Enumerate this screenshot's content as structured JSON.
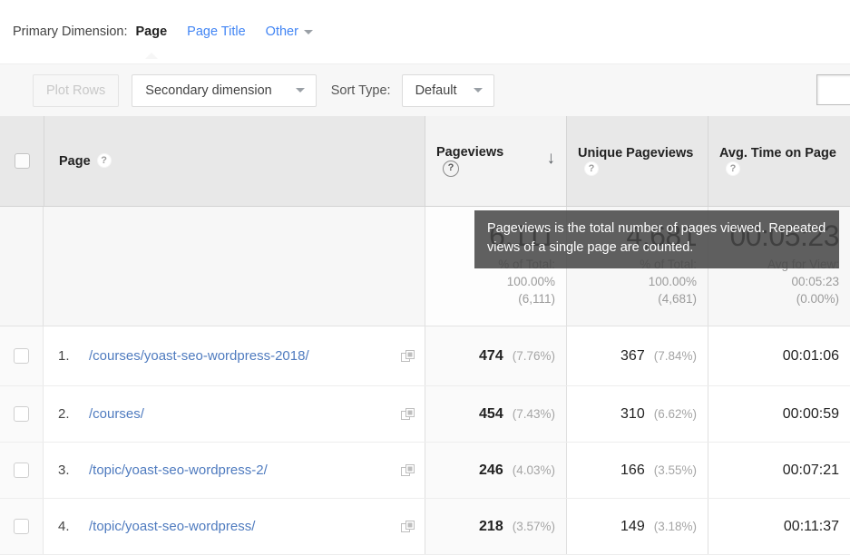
{
  "primary_dimension": {
    "label": "Primary Dimension:",
    "items": [
      {
        "label": "Page",
        "active": true
      },
      {
        "label": "Page Title",
        "active": false
      }
    ],
    "other_label": "Other"
  },
  "toolbar": {
    "plot_rows_label": "Plot Rows",
    "secondary_dimension_label": "Secondary dimension",
    "sort_type_label": "Sort Type:",
    "sort_type_value": "Default",
    "search_value": "",
    "search_placeholder": ""
  },
  "table": {
    "columns": [
      {
        "title": "Page",
        "help": true,
        "sorted": false
      },
      {
        "title": "Pageviews",
        "help": true,
        "sorted": true,
        "sort_direction": "desc",
        "sort_arrow": "↓"
      },
      {
        "title": "Unique Pageviews",
        "help": true,
        "sorted": false
      },
      {
        "title": "Avg. Time on Page",
        "help": true,
        "sorted": false
      }
    ],
    "summary": {
      "pageviews": {
        "total": "6,111",
        "label": "% of Total:",
        "percent": "100.00%",
        "value": "(6,111)"
      },
      "unique_pageviews": {
        "total": "4,681",
        "label": "% of Total:",
        "percent": "100.00%",
        "value": "(4,681)"
      },
      "avg_time_on_page": {
        "total": "00:05:23",
        "label": "Avg for View:",
        "percent": "00:05:23",
        "value": "(0.00%)"
      }
    },
    "rows": [
      {
        "index": "1.",
        "page": "/courses/yoast-seo-wordpress-2018/",
        "pageviews": "474",
        "pageviews_pct": "(7.76%)",
        "unique_pageviews": "367",
        "unique_pageviews_pct": "(7.84%)",
        "avg_time_on_page": "00:01:06"
      },
      {
        "index": "2.",
        "page": "/courses/",
        "pageviews": "454",
        "pageviews_pct": "(7.43%)",
        "unique_pageviews": "310",
        "unique_pageviews_pct": "(6.62%)",
        "avg_time_on_page": "00:00:59"
      },
      {
        "index": "3.",
        "page": "/topic/yoast-seo-wordpress-2/",
        "pageviews": "246",
        "pageviews_pct": "(4.03%)",
        "unique_pageviews": "166",
        "unique_pageviews_pct": "(3.55%)",
        "avg_time_on_page": "00:07:21"
      },
      {
        "index": "4.",
        "page": "/topic/yoast-seo-wordpress/",
        "pageviews": "218",
        "pageviews_pct": "(3.57%)",
        "unique_pageviews": "149",
        "unique_pageviews_pct": "(3.18%)",
        "avg_time_on_page": "00:11:37"
      }
    ]
  },
  "tooltip": {
    "text": "Pageviews is the total number of pages viewed. Repeated views of a single page are counted."
  },
  "icons": {
    "help": "?",
    "sort_desc": "↓"
  },
  "colors": {
    "link": "#4285f4",
    "page_link": "#4f7bbf",
    "header_bg": "#e8e8e8",
    "tooltip_bg": "#464646"
  }
}
